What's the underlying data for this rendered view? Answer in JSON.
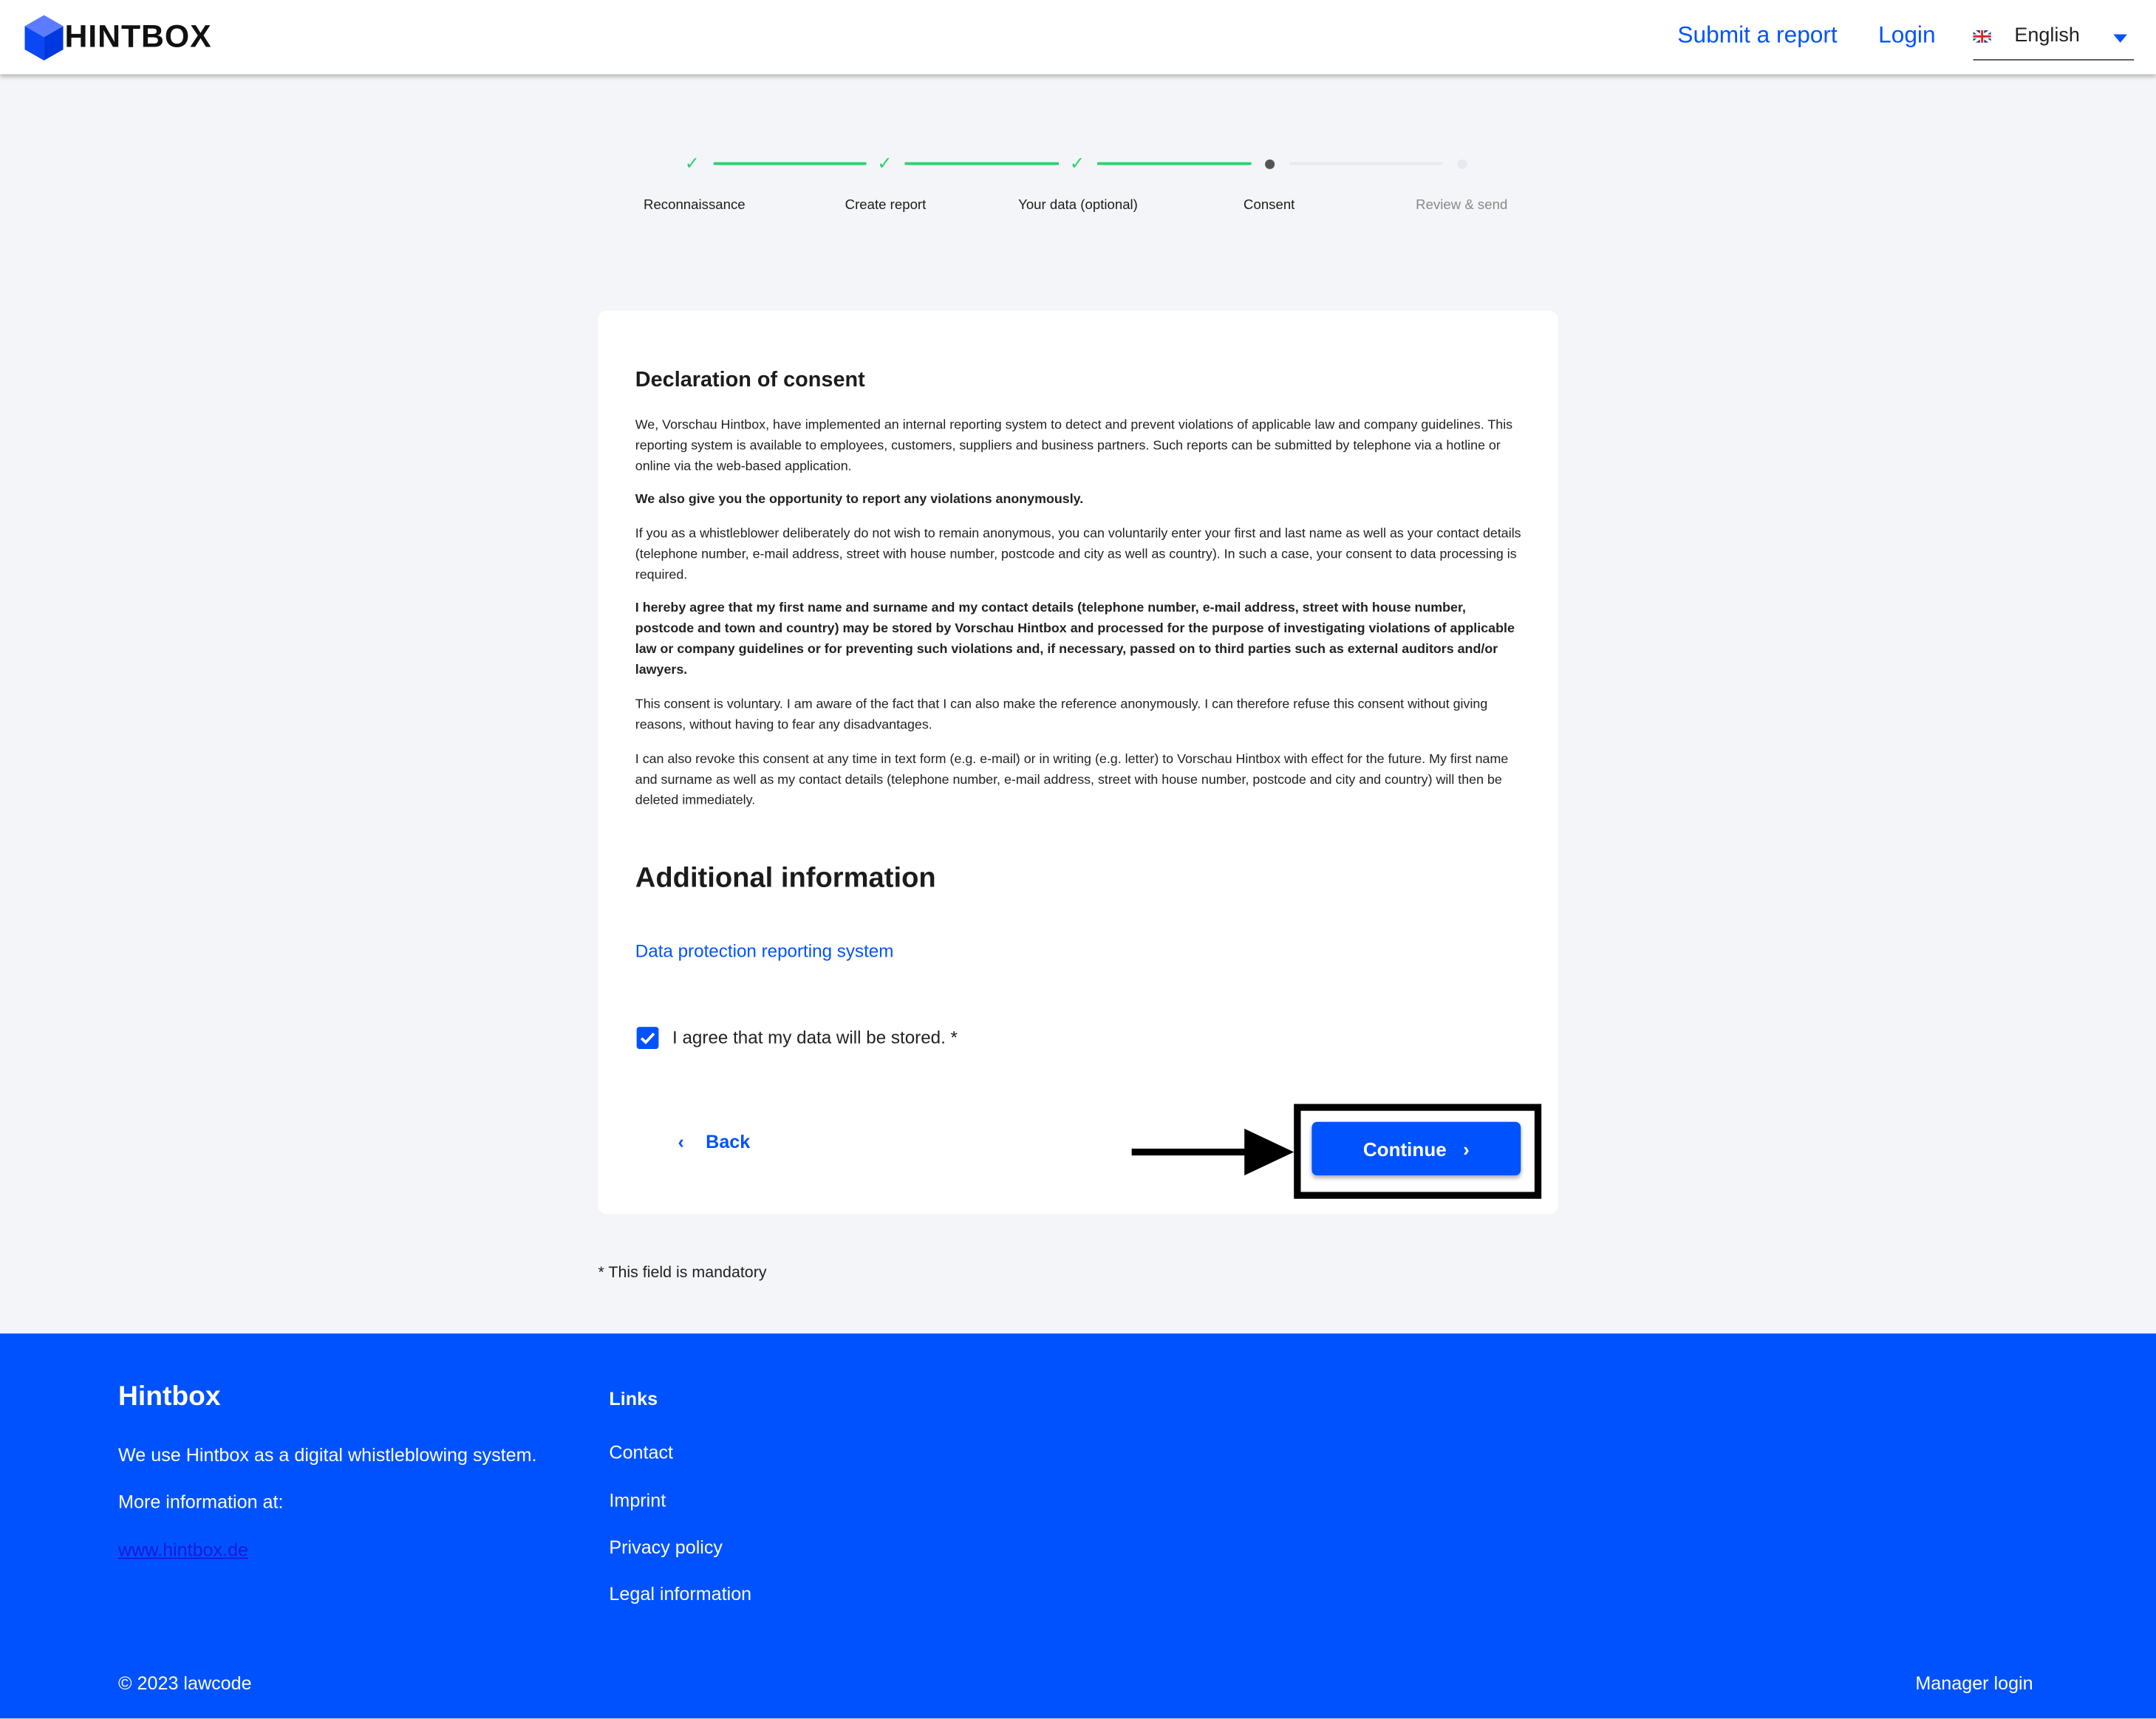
{
  "header": {
    "brand": "HINTBOX",
    "submit_report": "Submit a report",
    "login": "Login",
    "language": "English",
    "colors": {
      "brand": "#0052ff"
    }
  },
  "stepper": {
    "steps": [
      {
        "label": "Reconnaissance",
        "state": "done"
      },
      {
        "label": "Create report",
        "state": "done"
      },
      {
        "label": "Your data (optional)",
        "state": "done"
      },
      {
        "label": "Consent",
        "state": "current"
      },
      {
        "label": "Review & send",
        "state": "pending"
      }
    ]
  },
  "consent": {
    "title": "Declaration of consent",
    "paragraphs": [
      "We, Vorschau Hintbox, have implemented an internal reporting system to detect and prevent violations of applicable law and company guidelines. This reporting system is available to employees, customers, suppliers and business partners. Such reports can be submitted by telephone via a hotline or online via the web-based application.",
      "We also give you the opportunity to report any violations anonymously.",
      "If you as a whistleblower deliberately do not wish to remain anonymous, you can voluntarily enter your first and last name as well as your contact details (telephone number, e-mail address, street with house number, postcode and city as well as country). In such a case, your consent to data processing is required.",
      "I hereby agree that my first name and surname and my contact details (telephone number, e-mail address, street with house number, postcode and town and country) may be stored by Vorschau Hintbox and processed for the purpose of investigating violations of applicable law or company guidelines or for preventing such violations and, if necessary, passed on to third parties such as external auditors and/or lawyers.",
      "This consent is voluntary. I am aware of the fact that I can also make the reference anonymously. I can therefore refuse this consent without giving reasons, without having to fear any disadvantages.",
      "I can also revoke this consent at any time in text form (e.g. e-mail) or in writing (e.g. letter) to Vorschau Hintbox with effect for the future. My first name and surname as well as my contact details (telephone number, e-mail address, street with house number, postcode and city and country) will then be deleted immediately."
    ],
    "additional_title": "Additional information",
    "data_protection_link": "Data protection reporting system",
    "agree_label": "I agree that my data will be stored. *",
    "agree_checked": true,
    "back": "Back",
    "continue": "Continue"
  },
  "mandatory_note": "* This field is mandatory",
  "footer": {
    "brand": "Hintbox",
    "desc": "We use Hintbox as a digital whistleblowing system.",
    "more": "More information at:",
    "website": "www.hintbox.de",
    "links_title": "Links",
    "links": [
      "Contact",
      "Imprint",
      "Privacy policy",
      "Legal information"
    ],
    "copyright": "© 2023 lawcode",
    "manager_login": "Manager login"
  }
}
